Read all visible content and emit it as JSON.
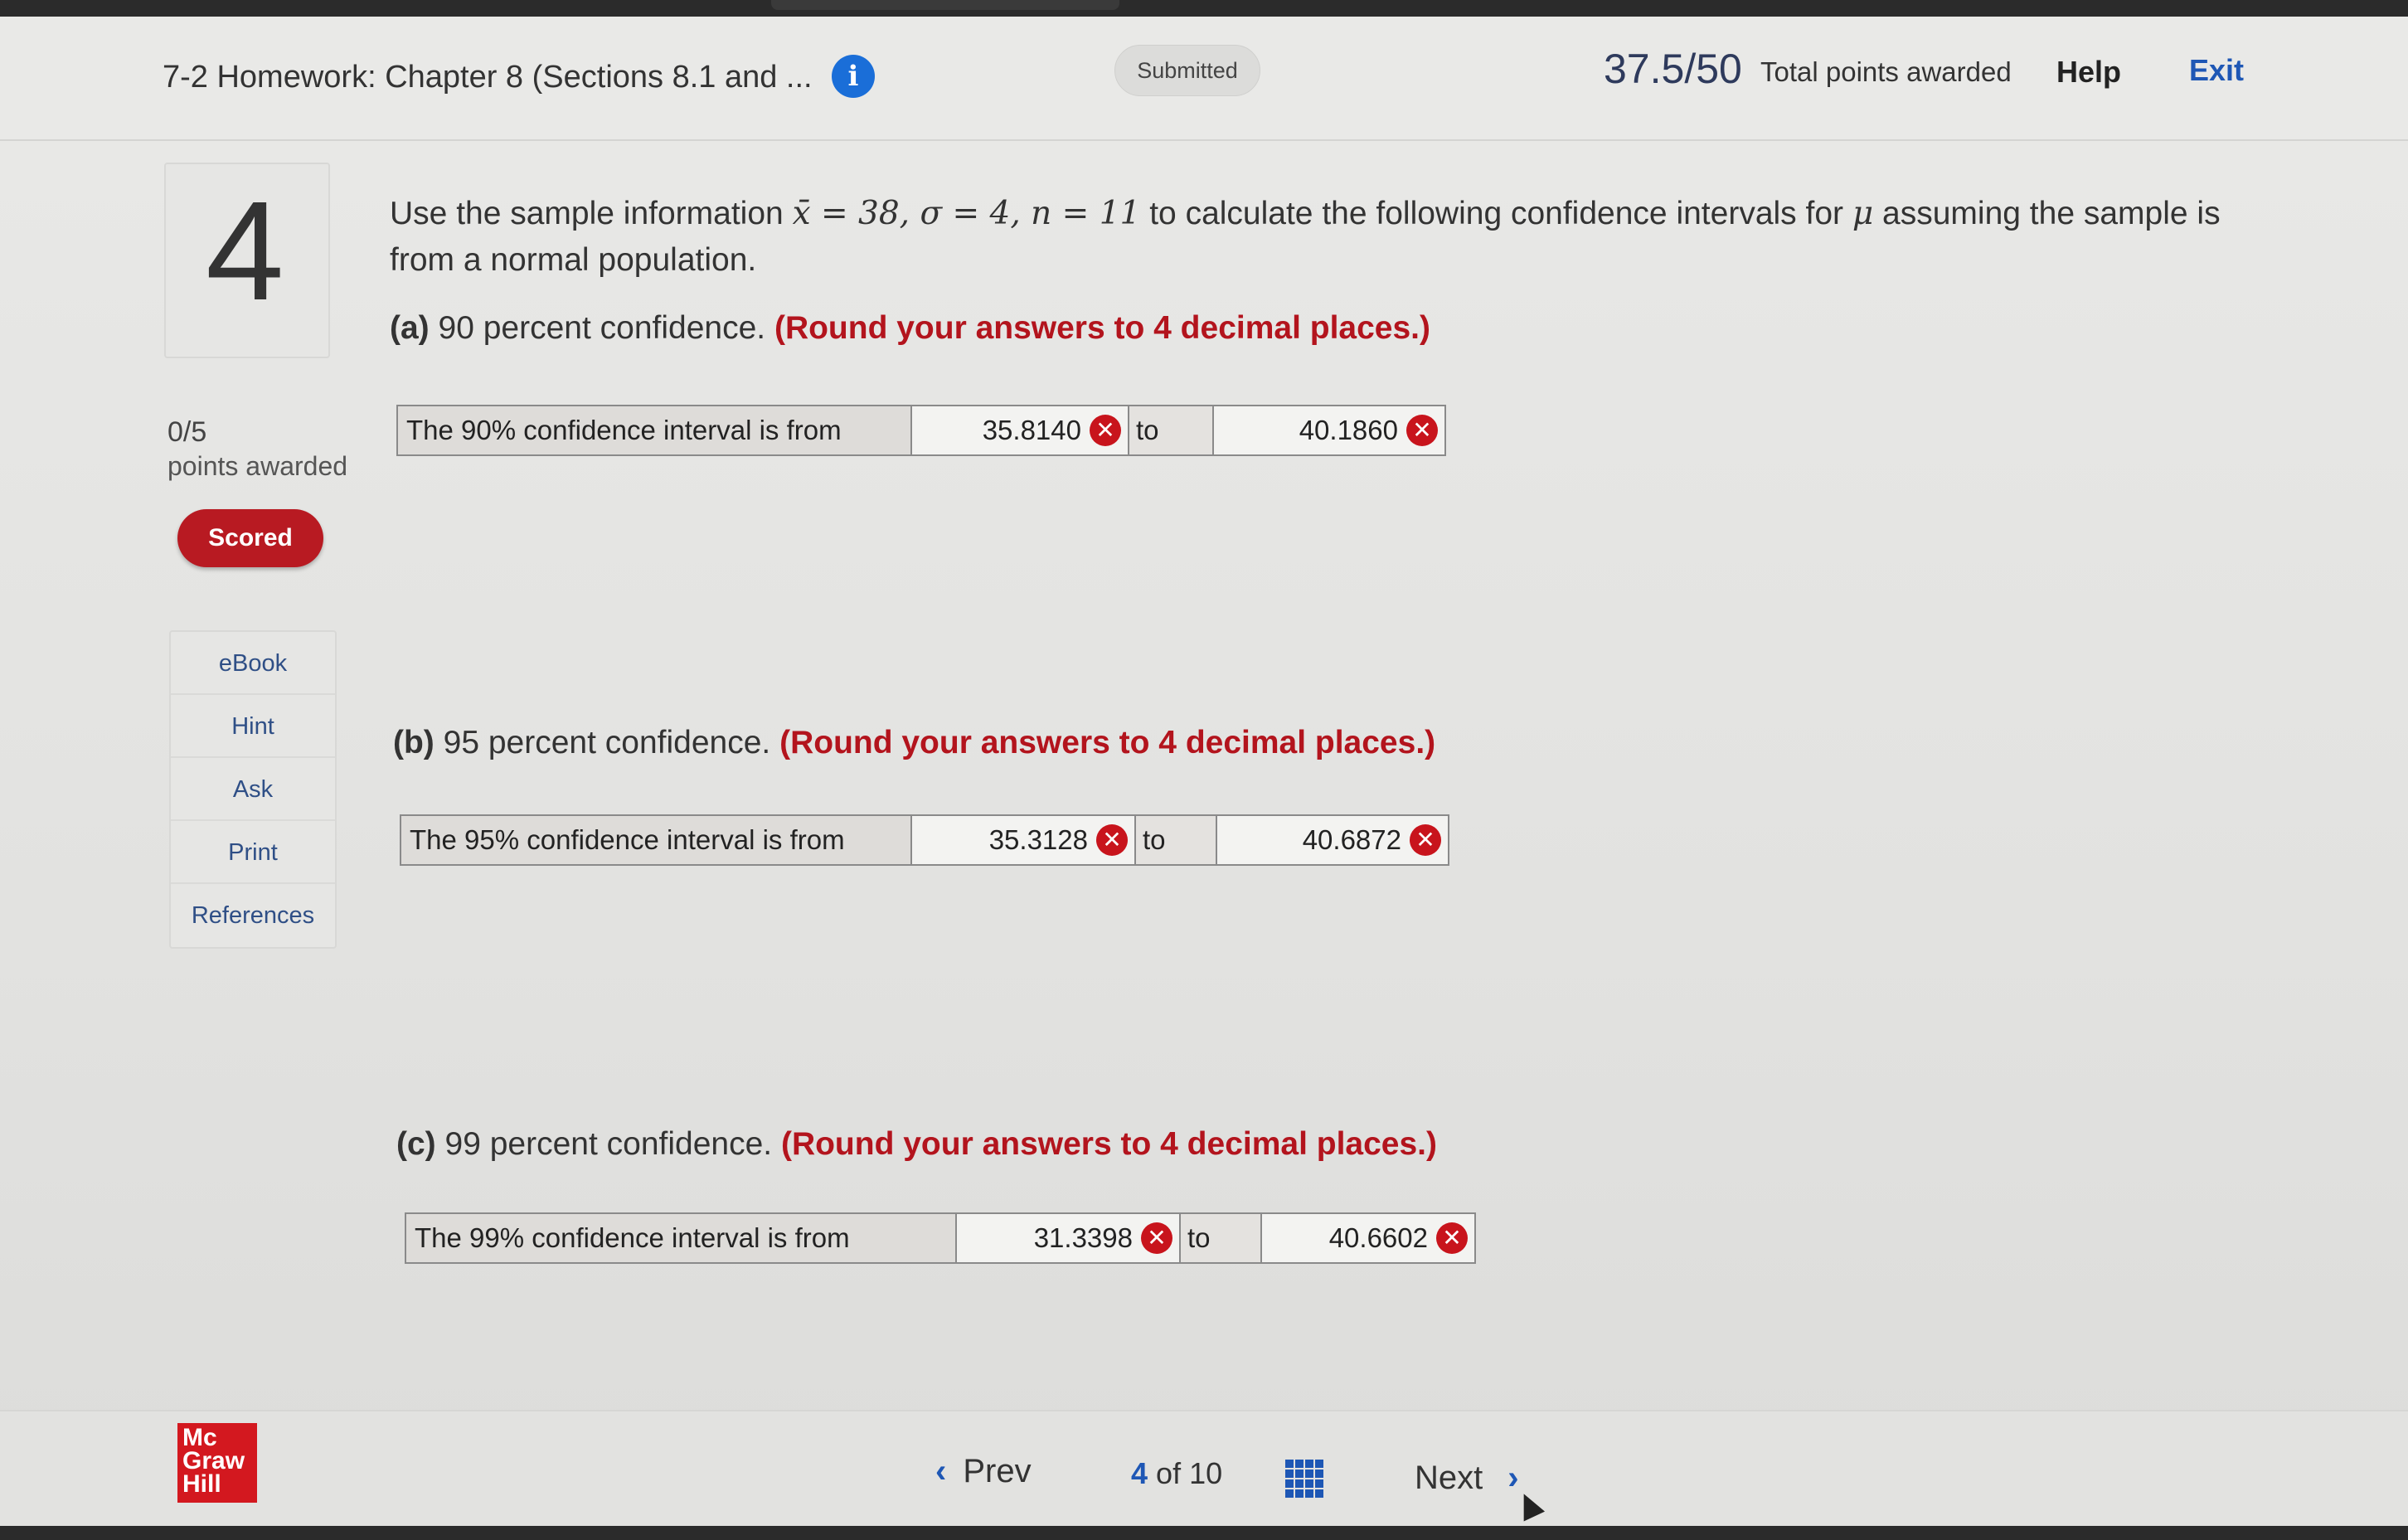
{
  "header": {
    "assignment_title": "7-2 Homework: Chapter 8 (Sections 8.1 and ...",
    "status": "Submitted",
    "score": "37.5/50",
    "score_label": "Total points awarded",
    "help": "Help",
    "exit": "Exit"
  },
  "question": {
    "number": "4",
    "points_value": "0/5",
    "points_label": "points awarded",
    "badge": "Scored",
    "stem_prefix": "Use the sample information ",
    "stem_vars": "x̄ = 38, σ = 4, n = 11",
    "stem_middle": " to calculate the following confidence intervals for ",
    "stem_mu": "μ",
    "stem_suffix": " assuming the sample is from a normal population."
  },
  "side_menu": [
    "eBook",
    "Hint",
    "Ask",
    "Print",
    "References"
  ],
  "parts": [
    {
      "letter": "(a)",
      "text": " 90 percent confidence. ",
      "instruction": "(Round your answers to 4 decimal places.)",
      "row_label": "The 90% confidence interval is from",
      "lower": "35.8140",
      "to": "to",
      "upper": "40.1860"
    },
    {
      "letter": "(b)",
      "text": " 95 percent confidence. ",
      "instruction": "(Round your answers to 4 decimal places.)",
      "row_label": "The 95% confidence interval is from",
      "lower": "35.3128",
      "to": "to",
      "upper": "40.6872"
    },
    {
      "letter": "(c)",
      "text": " 99 percent confidence. ",
      "instruction": "(Round your answers to 4 decimal places.)",
      "row_label": "The 99% confidence interval is from",
      "lower": "31.3398",
      "to": "to",
      "upper": "40.6602"
    }
  ],
  "icons": {
    "wrong": "✕",
    "info": "i",
    "prev_chevron": "‹",
    "next_chevron": "›"
  },
  "footer": {
    "logo_line1": "Mc",
    "logo_line2": "Graw",
    "logo_line3": "Hill",
    "prev": "Prev",
    "current_page": "4",
    "of_label": "of",
    "total_pages": "10",
    "next": "Next"
  },
  "colors": {
    "accent_blue": "#1e57b5",
    "error_red": "#c8141c",
    "instruction_red": "#b3141d",
    "badge_red": "#b81a22"
  }
}
